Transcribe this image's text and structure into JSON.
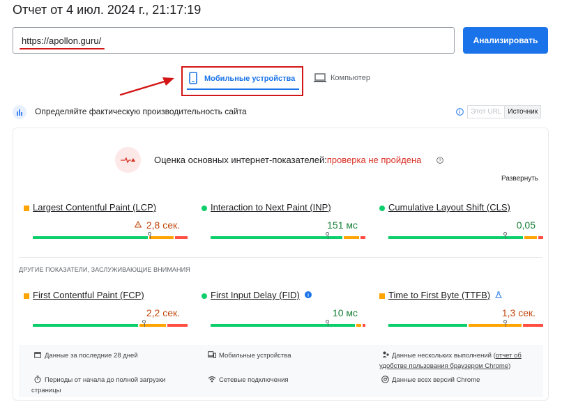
{
  "report": {
    "title": "Отчет от 4 июл. 2024 г., 21:17:19"
  },
  "url_input": {
    "value": "https://apollon.guru/"
  },
  "analyze_button": {
    "label": "Анализировать"
  },
  "tabs": [
    {
      "label": "Мобильные устройства",
      "icon": "smartphone-icon",
      "selected": true
    },
    {
      "label": "Компьютер",
      "icon": "laptop-icon",
      "selected": false
    }
  ],
  "field_data": {
    "heading": "Определяйте фактическую производительность сайта",
    "toggle": {
      "option_url": "Этот URL",
      "option_origin": "Источник",
      "selected": "Источник"
    }
  },
  "assessment": {
    "label": "Оценка основных интернет-показателей:",
    "result": "проверка не пройдена",
    "expand_label": "Развернуть",
    "status_color": "#d93025"
  },
  "core_metrics": [
    {
      "name": "Largest Contentful Paint (LCP)",
      "value": "2,8 сек.",
      "status": "needs-improvement",
      "distribution": {
        "good": 0.75,
        "needs_improvement": 0.17,
        "poor": 0.08
      },
      "marker": 0.755
    },
    {
      "name": "Interaction to Next Paint (INP)",
      "value": "151 мс",
      "status": "good",
      "distribution": {
        "good": 0.86,
        "needs_improvement": 0.11,
        "poor": 0.03
      },
      "marker": 0.755
    },
    {
      "name": "Cumulative Layout Shift (CLS)",
      "value": "0,05",
      "status": "good",
      "distribution": {
        "good": 0.88,
        "needs_improvement": 0.09,
        "poor": 0.03
      },
      "marker": 0.755
    }
  ],
  "other_metrics": {
    "title": "ДРУГИЕ ПОКАЗАТЕЛИ, ЗАСЛУЖИВАЮЩИЕ ВНИМАНИЯ",
    "items": [
      {
        "name": "First Contentful Paint (FCP)",
        "value": "2,2 сек.",
        "status": "needs-improvement",
        "distribution": {
          "good": 0.69,
          "needs_improvement": 0.18,
          "poor": 0.13
        },
        "marker": 0.72
      },
      {
        "name": "First Input Delay (FID)",
        "value": "10 мс",
        "status": "good",
        "distribution": {
          "good": 0.94,
          "needs_improvement": 0.04,
          "poor": 0.02
        },
        "marker": 0.755
      },
      {
        "name": "Time to First Byte (TTFB)",
        "value": "1,3 сек.",
        "status": "needs-improvement",
        "distribution": {
          "good": 0.52,
          "needs_improvement": 0.35,
          "poor": 0.13
        },
        "marker": 0.755
      }
    ]
  },
  "info": {
    "period": "Данные за последние 28 дней",
    "device": "Мобильные устройства",
    "samples": "Данные нескольких выполнений (",
    "samples_link": "отчет об удобстве пользования браузером Chrome",
    "samples_close": ")",
    "duration": "Периоды от начала до полной загрузки страницы",
    "network": "Сетевые подключения",
    "versions": "Данные всех версий Chrome"
  },
  "colors": {
    "accent": "#1a73e8",
    "good": "#0cce6b",
    "average": "#ffa400",
    "poor": "#ff4e42",
    "highlight": "#d31515"
  }
}
